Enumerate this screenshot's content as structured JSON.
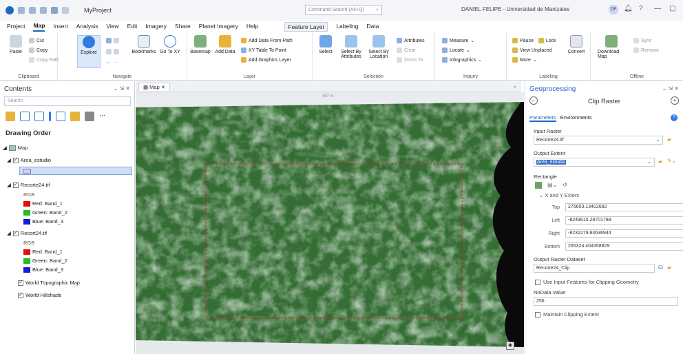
{
  "titlebar": {
    "project_name": "MyProject",
    "search_placeholder": "Command Search (Alt+Q)",
    "user": "DANIEL FELIPE - Universidad de Manizales",
    "avatar_initials": "DF",
    "help": "?",
    "minimize": "—",
    "restore": "▢"
  },
  "tabs": [
    "Project",
    "Map",
    "Insert",
    "Analysis",
    "View",
    "Edit",
    "Imagery",
    "Share",
    "Planet Imagery",
    "Help"
  ],
  "active_tab": "Map",
  "context_tabs": {
    "group": "Feature Layer",
    "items": [
      "Labeling",
      "Data"
    ]
  },
  "ribbon": {
    "clipboard": {
      "label": "Clipboard",
      "paste": "Paste",
      "cut": "Cut",
      "copy": "Copy",
      "copy_path": "Copy Path"
    },
    "navigate": {
      "label": "Navigate",
      "explore": "Explore",
      "bookmarks": "Bookmarks",
      "goto": "Go To XY"
    },
    "layer": {
      "label": "Layer",
      "basemap": "Basemap",
      "add_data": "Add Data",
      "add_from_path": "Add Data From Path",
      "xy_table": "XY Table To Point",
      "add_graphics": "Add Graphics Layer"
    },
    "selection": {
      "label": "Selection",
      "select": "Select",
      "by_attributes": "Select By Attributes",
      "by_location": "Select By Location",
      "attributes": "Attributes",
      "clear": "Clear",
      "zoom_to": "Zoom To"
    },
    "inquiry": {
      "label": "Inquiry",
      "measure": "Measure",
      "locate": "Locate",
      "infographics": "Infographics"
    },
    "labeling": {
      "label": "Labeling",
      "pause": "Pause",
      "lock": "Lock",
      "view_unplaced": "View Unplaced",
      "more": "More",
      "convert": "Convert"
    },
    "offline": {
      "label": "Offline",
      "download_map": "Download Map",
      "sync": "Sync",
      "remove": "Remove"
    }
  },
  "contents": {
    "title": "Contents",
    "search_placeholder": "Search",
    "drawing_order": "Drawing Order",
    "map_item": "Map",
    "layers": [
      {
        "name": "Area_estudio"
      },
      {
        "name": "Recorte24.tif",
        "rgb": "RGB",
        "bands": [
          "Red:  Band_1",
          "Green: Band_2",
          "Blue:  Band_3"
        ]
      },
      {
        "name": "Recort24.tif",
        "rgb": "RGB",
        "bands": [
          "Red:  Band_1",
          "Green: Band_2",
          "Blue:  Band_3"
        ]
      }
    ],
    "basemaps": [
      "World Topographic Map",
      "World Hillshade"
    ]
  },
  "map": {
    "tab_label": "Map",
    "scale_text": "457 m"
  },
  "geoprocessing": {
    "title": "Geoprocessing",
    "tool_name": "Clip Raster",
    "tab_parameters": "Parameters",
    "tab_environments": "Environments",
    "input_raster_label": "Input Raster",
    "input_raster": "Recorte24.tif",
    "output_extent_label": "Output Extent",
    "output_extent": "Area_estudio",
    "rectangle_label": "Rectangle",
    "xy_extent": "X and Y Extent",
    "top_label": "Top",
    "top": "275603.13402692",
    "left_label": "Left",
    "left": "-8249615.28701788",
    "right_label": "Right",
    "right": "-8232279.84636944",
    "bottom_label": "Bottom",
    "bottom": "265324.404358829",
    "output_raster_label": "Output Raster Dataset",
    "output_raster": "Recorte24_Clip",
    "use_input_features": "Use Input Features for Clipping Geometry",
    "nodata_label": "NoData Value",
    "nodata": "256",
    "maintain_extent": "Maintain Clipping Extent"
  },
  "colors": {
    "accent": "#1f66c1",
    "red_swatch": "#e01010",
    "green_swatch": "#1ec01e",
    "blue_swatch": "#1020d0",
    "extent_rect": "#d22020"
  }
}
